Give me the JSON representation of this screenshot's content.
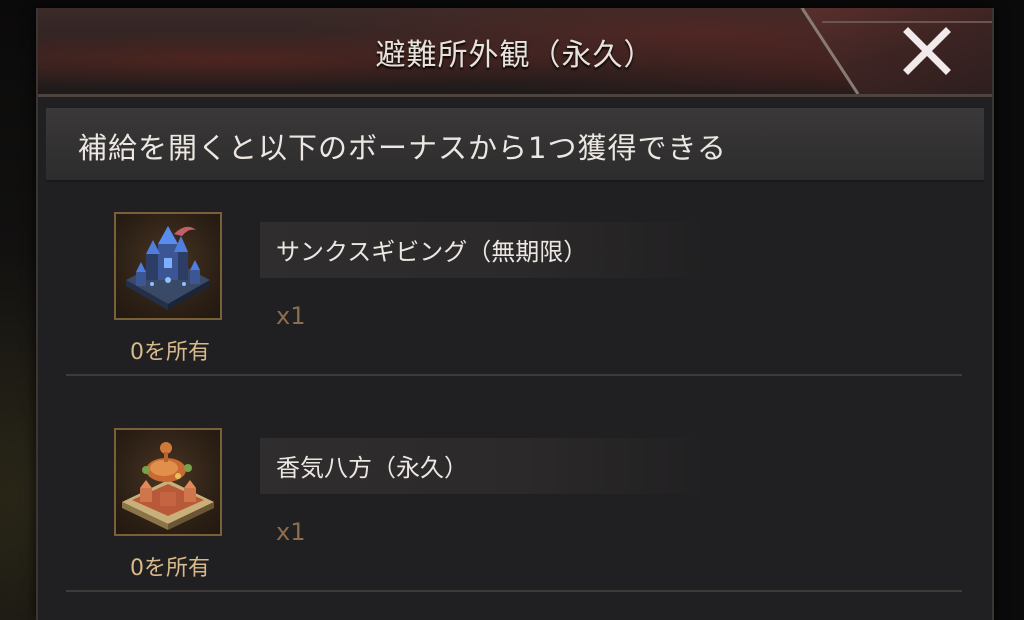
{
  "dialog": {
    "title": "避難所外観（永久）",
    "close_icon": "close-x-icon"
  },
  "info": {
    "text": "補給を開くと以下のボーナスから1つ獲得できる"
  },
  "rewards": [
    {
      "name": "サンクスギビング（無期限）",
      "quantity": "x1",
      "owned": "0を所有",
      "icon": "blue-castle-icon"
    },
    {
      "name": "香気八方（永久）",
      "quantity": "x1",
      "owned": "0を所有",
      "icon": "orange-castle-icon"
    }
  ],
  "colors": {
    "title_text": "#e8e2dc",
    "owned_text": "#d8b98a",
    "quantity_text": "#8a6e4c",
    "panel_bg": "#201f21"
  }
}
